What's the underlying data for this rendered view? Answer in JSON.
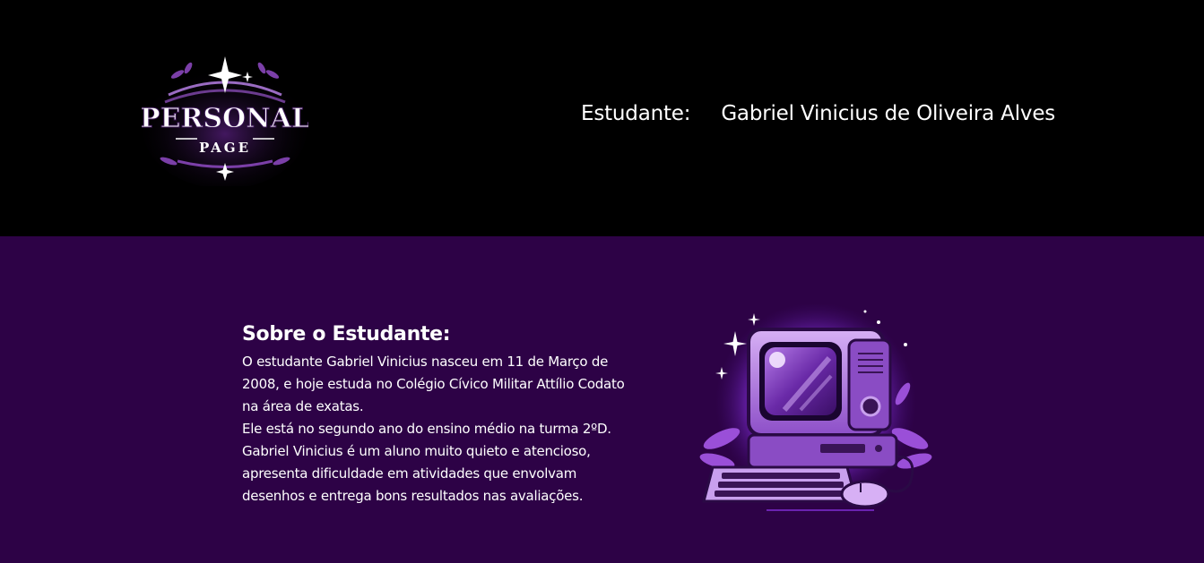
{
  "header": {
    "logo": {
      "line1": "PERSONAL",
      "line2": "PAGE",
      "icon": "personal-page-logo"
    },
    "student_label": "Estudante:",
    "student_name": "Gabriel Vinicius de Oliveira Alves"
  },
  "about": {
    "title": "Sobre o Estudante:",
    "body": "O estudante Gabriel Vinicius nasceu em 11 de Março de\n2008, e hoje estuda no Colégio Cívico Militar Attílio Codato\nna área de exatas.\nEle está no segundo ano do ensino médio na turma 2ºD.\nGabriel Vinicius é um aluno muito quieto e atencioso,\napresenta dificuldade em atividades que envolvam\ndesenhos e entrega bons resultados nas avaliações.",
    "illustration": "retro-computer-illustration"
  },
  "colors": {
    "header_bg": "#000000",
    "main_bg": "#2d0246",
    "accent": "#8a3fd1",
    "text": "#ffffff"
  }
}
